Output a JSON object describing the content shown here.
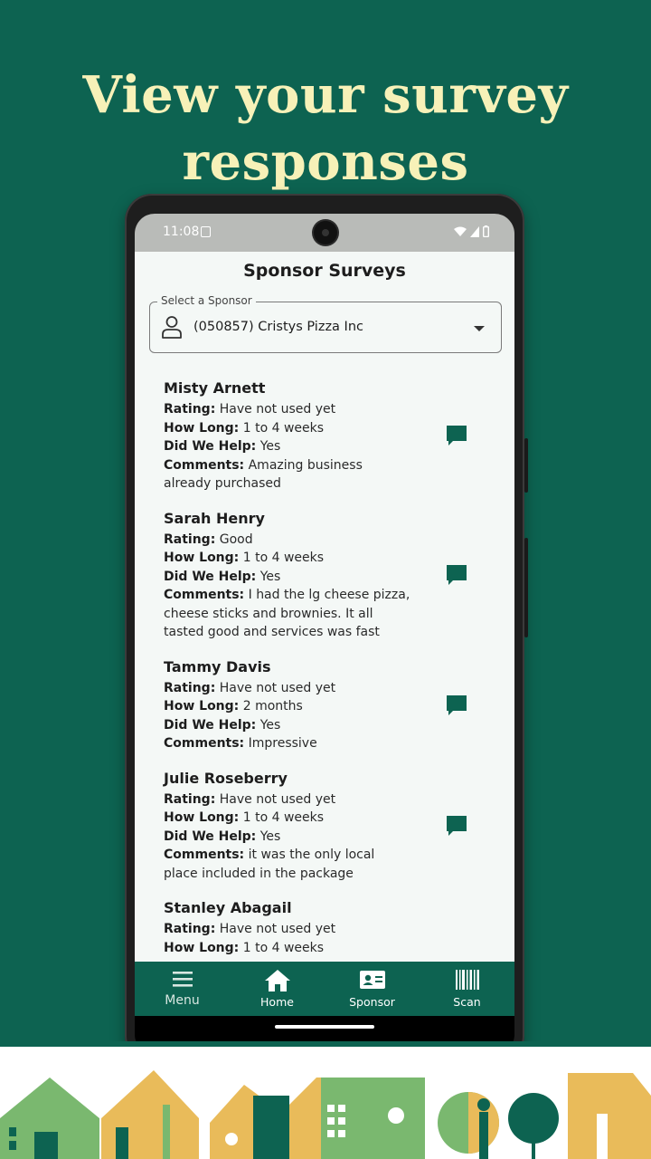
{
  "headline": {
    "line1": "View your survey",
    "line2": "responses"
  },
  "status_bar": {
    "time": "11:08"
  },
  "app": {
    "title": "Sponsor Surveys",
    "sponsor_select": {
      "label": "Select a Sponsor",
      "value": "(050857) Cristys Pizza Inc",
      "icon": "person-icon"
    },
    "field_labels": {
      "rating": "Rating:",
      "how_long": "How Long:",
      "did_we_help": "Did We Help:",
      "comments": "Comments:"
    },
    "responses": [
      {
        "name": "Misty Arnett",
        "rating": "Have not used yet",
        "how_long": "1 to 4 weeks",
        "did_we_help": "Yes",
        "comments": "Amazing business already purchased"
      },
      {
        "name": "Sarah Henry",
        "rating": "Good",
        "how_long": "1 to 4 weeks",
        "did_we_help": "Yes",
        "comments": "I had the lg cheese pizza, cheese sticks and brownies. It all tasted good and services was fast"
      },
      {
        "name": "Tammy Davis",
        "rating": "Have not used yet",
        "how_long": "2 months",
        "did_we_help": "Yes",
        "comments": "Impressive"
      },
      {
        "name": "Julie Roseberry",
        "rating": "Have not used yet",
        "how_long": "1 to 4 weeks",
        "did_we_help": "Yes",
        "comments": "it was the only local place included in the package"
      },
      {
        "name": "Stanley Abagail",
        "rating": "Have not used yet",
        "how_long": "1 to 4 weeks",
        "did_we_help": "",
        "comments": ""
      }
    ],
    "nav": [
      {
        "label": "Menu",
        "icon": "menu-icon"
      },
      {
        "label": "Home",
        "icon": "home-icon"
      },
      {
        "label": "Sponsor",
        "icon": "id-card-icon"
      },
      {
        "label": "Scan",
        "icon": "barcode-icon"
      }
    ]
  },
  "colors": {
    "background": "#0d6351",
    "headline": "#f7f1b8",
    "accent": "#0d6351",
    "screen_bg": "#f4f8f6"
  }
}
